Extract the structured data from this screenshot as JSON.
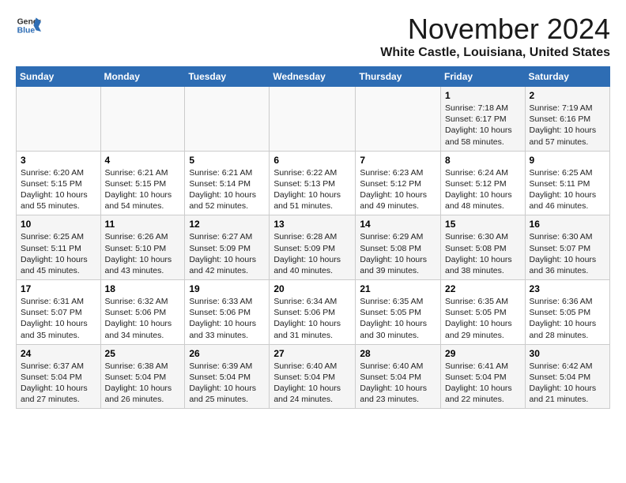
{
  "header": {
    "logo_general": "General",
    "logo_blue": "Blue",
    "month_title": "November 2024",
    "location": "White Castle, Louisiana, United States"
  },
  "weekdays": [
    "Sunday",
    "Monday",
    "Tuesday",
    "Wednesday",
    "Thursday",
    "Friday",
    "Saturday"
  ],
  "weeks": [
    [
      {
        "day": "",
        "info": ""
      },
      {
        "day": "",
        "info": ""
      },
      {
        "day": "",
        "info": ""
      },
      {
        "day": "",
        "info": ""
      },
      {
        "day": "",
        "info": ""
      },
      {
        "day": "1",
        "info": "Sunrise: 7:18 AM\nSunset: 6:17 PM\nDaylight: 10 hours\nand 58 minutes."
      },
      {
        "day": "2",
        "info": "Sunrise: 7:19 AM\nSunset: 6:16 PM\nDaylight: 10 hours\nand 57 minutes."
      }
    ],
    [
      {
        "day": "3",
        "info": "Sunrise: 6:20 AM\nSunset: 5:15 PM\nDaylight: 10 hours\nand 55 minutes."
      },
      {
        "day": "4",
        "info": "Sunrise: 6:21 AM\nSunset: 5:15 PM\nDaylight: 10 hours\nand 54 minutes."
      },
      {
        "day": "5",
        "info": "Sunrise: 6:21 AM\nSunset: 5:14 PM\nDaylight: 10 hours\nand 52 minutes."
      },
      {
        "day": "6",
        "info": "Sunrise: 6:22 AM\nSunset: 5:13 PM\nDaylight: 10 hours\nand 51 minutes."
      },
      {
        "day": "7",
        "info": "Sunrise: 6:23 AM\nSunset: 5:12 PM\nDaylight: 10 hours\nand 49 minutes."
      },
      {
        "day": "8",
        "info": "Sunrise: 6:24 AM\nSunset: 5:12 PM\nDaylight: 10 hours\nand 48 minutes."
      },
      {
        "day": "9",
        "info": "Sunrise: 6:25 AM\nSunset: 5:11 PM\nDaylight: 10 hours\nand 46 minutes."
      }
    ],
    [
      {
        "day": "10",
        "info": "Sunrise: 6:25 AM\nSunset: 5:11 PM\nDaylight: 10 hours\nand 45 minutes."
      },
      {
        "day": "11",
        "info": "Sunrise: 6:26 AM\nSunset: 5:10 PM\nDaylight: 10 hours\nand 43 minutes."
      },
      {
        "day": "12",
        "info": "Sunrise: 6:27 AM\nSunset: 5:09 PM\nDaylight: 10 hours\nand 42 minutes."
      },
      {
        "day": "13",
        "info": "Sunrise: 6:28 AM\nSunset: 5:09 PM\nDaylight: 10 hours\nand 40 minutes."
      },
      {
        "day": "14",
        "info": "Sunrise: 6:29 AM\nSunset: 5:08 PM\nDaylight: 10 hours\nand 39 minutes."
      },
      {
        "day": "15",
        "info": "Sunrise: 6:30 AM\nSunset: 5:08 PM\nDaylight: 10 hours\nand 38 minutes."
      },
      {
        "day": "16",
        "info": "Sunrise: 6:30 AM\nSunset: 5:07 PM\nDaylight: 10 hours\nand 36 minutes."
      }
    ],
    [
      {
        "day": "17",
        "info": "Sunrise: 6:31 AM\nSunset: 5:07 PM\nDaylight: 10 hours\nand 35 minutes."
      },
      {
        "day": "18",
        "info": "Sunrise: 6:32 AM\nSunset: 5:06 PM\nDaylight: 10 hours\nand 34 minutes."
      },
      {
        "day": "19",
        "info": "Sunrise: 6:33 AM\nSunset: 5:06 PM\nDaylight: 10 hours\nand 33 minutes."
      },
      {
        "day": "20",
        "info": "Sunrise: 6:34 AM\nSunset: 5:06 PM\nDaylight: 10 hours\nand 31 minutes."
      },
      {
        "day": "21",
        "info": "Sunrise: 6:35 AM\nSunset: 5:05 PM\nDaylight: 10 hours\nand 30 minutes."
      },
      {
        "day": "22",
        "info": "Sunrise: 6:35 AM\nSunset: 5:05 PM\nDaylight: 10 hours\nand 29 minutes."
      },
      {
        "day": "23",
        "info": "Sunrise: 6:36 AM\nSunset: 5:05 PM\nDaylight: 10 hours\nand 28 minutes."
      }
    ],
    [
      {
        "day": "24",
        "info": "Sunrise: 6:37 AM\nSunset: 5:04 PM\nDaylight: 10 hours\nand 27 minutes."
      },
      {
        "day": "25",
        "info": "Sunrise: 6:38 AM\nSunset: 5:04 PM\nDaylight: 10 hours\nand 26 minutes."
      },
      {
        "day": "26",
        "info": "Sunrise: 6:39 AM\nSunset: 5:04 PM\nDaylight: 10 hours\nand 25 minutes."
      },
      {
        "day": "27",
        "info": "Sunrise: 6:40 AM\nSunset: 5:04 PM\nDaylight: 10 hours\nand 24 minutes."
      },
      {
        "day": "28",
        "info": "Sunrise: 6:40 AM\nSunset: 5:04 PM\nDaylight: 10 hours\nand 23 minutes."
      },
      {
        "day": "29",
        "info": "Sunrise: 6:41 AM\nSunset: 5:04 PM\nDaylight: 10 hours\nand 22 minutes."
      },
      {
        "day": "30",
        "info": "Sunrise: 6:42 AM\nSunset: 5:04 PM\nDaylight: 10 hours\nand 21 minutes."
      }
    ]
  ]
}
